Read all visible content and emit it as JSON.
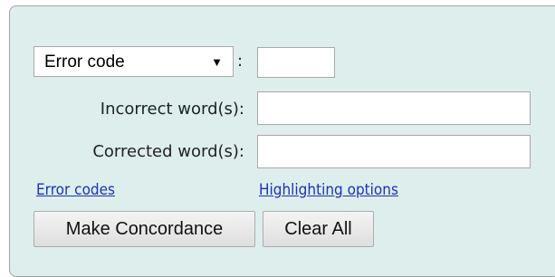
{
  "form": {
    "error_code_select": {
      "selected": "Error code",
      "caret": "▼"
    },
    "colon": ":",
    "error_code_value": "",
    "incorrect_label": "Incorrect word(s):",
    "incorrect_value": "",
    "corrected_label": "Corrected word(s):",
    "corrected_value": ""
  },
  "links": {
    "error_codes": "Error codes",
    "highlighting_options": "Highlighting options"
  },
  "buttons": {
    "make_concordance": "Make Concordance",
    "clear_all": "Clear All"
  },
  "colors": {
    "panel_bg": "#ddeeed",
    "link": "#1a33b8"
  }
}
